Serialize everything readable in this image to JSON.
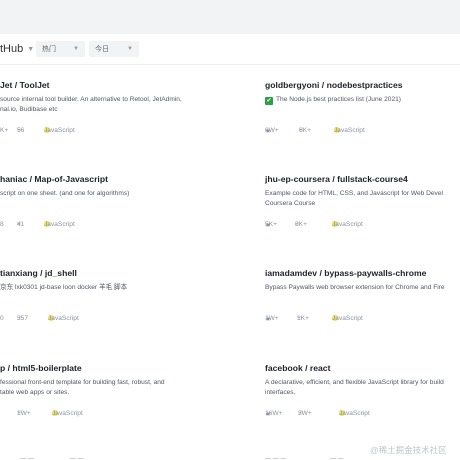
{
  "filters": {
    "source_label": "tHub",
    "category": "热门",
    "period": "今日"
  },
  "repos": [
    {
      "name": "Jet / ToolJet",
      "desc_lines": [
        "source internal tool builder. An alternative to Retool, JetAdmin,",
        "nal.io, Budibase etc"
      ],
      "stars": "K+",
      "forks": "56",
      "language": "JavaScript"
    },
    {
      "name": "goldbergyoni / nodebestpractices",
      "desc_lines": [
        "The Node.js best practices list (June 2021)"
      ],
      "check_emoji": true,
      "stars": "6W+",
      "forks": "6K+",
      "language": "JavaScript"
    },
    {
      "name": "haniac / Map-of-Javascript",
      "desc_lines": [
        "script on one sheet. (and one for algorithms)"
      ],
      "stars": "8",
      "forks": "41",
      "language": "JavaScript"
    },
    {
      "name": "jhu-ep-coursera / fullstack-course4",
      "desc_lines": [
        "Example code for HTML, CSS, and Javascript for Web Devel",
        "Coursera Course"
      ],
      "stars": "5K+",
      "forks": "8K+",
      "language": "JavaScript"
    },
    {
      "name": "tianxiang / jd_shell",
      "desc_lines": [
        "京东 lxk0301 jd-base loon docker 羊毛 脚本"
      ],
      "stars": "0",
      "forks": "357",
      "language": "JavaScript"
    },
    {
      "name": "iamadamdev / bypass-paywalls-chrome",
      "desc_lines": [
        "Bypass Paywalls web browser extension for Chrome and Fire"
      ],
      "stars": "1W+",
      "forks": "1K+",
      "language": "JavaScript"
    },
    {
      "name": "p / html5-boilerplate",
      "desc_lines": [
        "fessional front-end template for building fast, robust, and",
        "table web apps or sites."
      ],
      "stars": "",
      "forks": "1W+",
      "language": "JavaScript"
    },
    {
      "name": "facebook / react",
      "desc_lines": [
        "A declarative, efficient, and flexible JavaScript library for build",
        "interfaces."
      ],
      "stars": "16W+",
      "forks": "3W+",
      "language": "JavaScript"
    }
  ],
  "watermark": "@稀土掘金技术社区",
  "bottom_fragments": [
    "— —",
    "— —",
    "— — —",
    "— —"
  ]
}
